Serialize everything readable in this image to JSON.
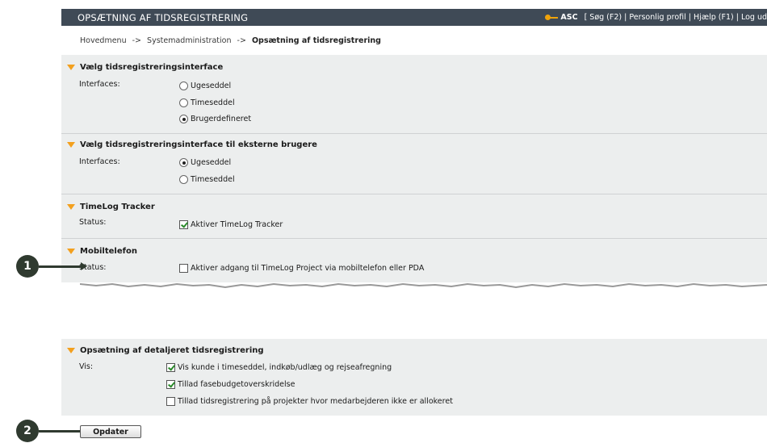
{
  "header": {
    "title": "OPSÆTNING AF TIDSREGISTRERING",
    "user": "ASC",
    "links": "[ Søg (F2) | Personlig profil | Hjælp (F1) | Log ud"
  },
  "breadcrumb": {
    "items": [
      "Hovedmenu",
      "Systemadministration",
      "Opsætning af tidsregistrering"
    ],
    "separator": "->"
  },
  "sections": {
    "interface": {
      "title": "Vælg tidsregistreringsinterface",
      "label": "Interfaces:",
      "options": [
        "Ugeseddel",
        "Timeseddel",
        "Brugerdefineret"
      ],
      "selected": "Brugerdefineret"
    },
    "external": {
      "title": "Vælg tidsregistreringsinterface til eksterne brugere",
      "label": "Interfaces:",
      "options": [
        "Ugeseddel",
        "Timeseddel"
      ],
      "selected": "Ugeseddel"
    },
    "tracker": {
      "title": "TimeLog Tracker",
      "label": "Status:",
      "checkbox": "Aktiver TimeLog Tracker",
      "checked": true
    },
    "mobile": {
      "title": "Mobiltelefon",
      "label": "Status:",
      "checkbox": "Aktiver adgang til TimeLog Project via mobiltelefon eller PDA",
      "checked": false
    },
    "detailed": {
      "title": "Opsætning af detaljeret tidsregistrering",
      "label": "Vis:",
      "checkboxes": [
        {
          "label": "Vis kunde i timeseddel, indkøb/udlæg og rejseafregning",
          "checked": true
        },
        {
          "label": "Tillad fasebudgetoverskridelse",
          "checked": true
        },
        {
          "label": "Tillad tidsregistrering på projekter hvor medarbejderen ikke er allokeret",
          "checked": false
        }
      ]
    }
  },
  "actions": {
    "update_label": "Opdater"
  },
  "callouts": [
    "1",
    "2"
  ],
  "colors": {
    "header_bg": "#3f4a56",
    "section_bg": "#eceeee",
    "accent": "#f3a01e"
  }
}
